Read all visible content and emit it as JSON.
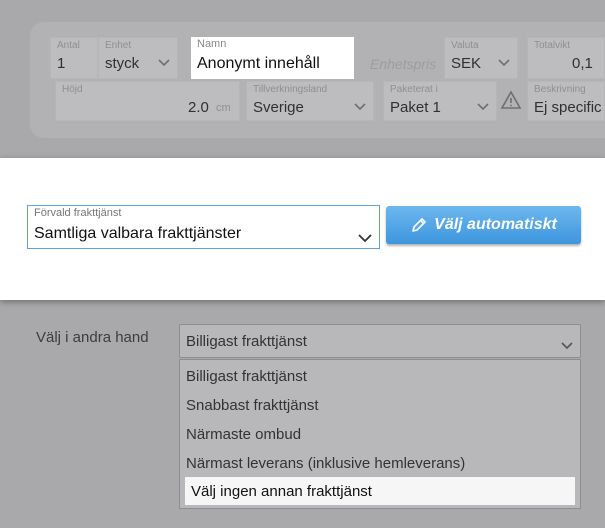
{
  "product_row": {
    "quantity": {
      "label": "Antal",
      "value": "1"
    },
    "unit": {
      "label": "Enhet",
      "value": "styck"
    },
    "name": {
      "label": "Namn",
      "value": "Anonymt innehåll"
    },
    "unit_price": {
      "placeholder": "Enhetspris"
    },
    "currency": {
      "label": "Valuta",
      "value": "SEK"
    },
    "total_weight": {
      "label": "Totalvikt",
      "value": "0,1"
    },
    "height": {
      "label": "Höjd",
      "value": "2.0",
      "unit": "cm"
    },
    "origin_country": {
      "label": "Tillverkningsland",
      "value": "Sverige"
    },
    "packaged_in": {
      "label": "Paketerat i",
      "value": "Paket 1"
    },
    "description": {
      "label": "Beskrivning",
      "value": "Ej specific"
    }
  },
  "primary": {
    "label": "Förvald frakttjänst",
    "value": "Samtliga valbara frakttjänster",
    "auto_button": "Välj automatiskt"
  },
  "secondary": {
    "label": "Välj i andra hand",
    "value": "Billigast frakttjänst",
    "options": [
      "Billigast frakttjänst",
      "Snabbast frakttjänst",
      "Närmaste ombud",
      "Närmast leverans (inklusive hemleverans)",
      "Välj ingen annan frakttjänst"
    ],
    "highlighted_index": 4
  },
  "colors": {
    "accent": "#4aa3e6",
    "overlay": "#a9a9ab"
  },
  "icons": {
    "dropdown": "chevron-down-icon",
    "auto": "pencil-icon",
    "warning": "warning-icon"
  }
}
